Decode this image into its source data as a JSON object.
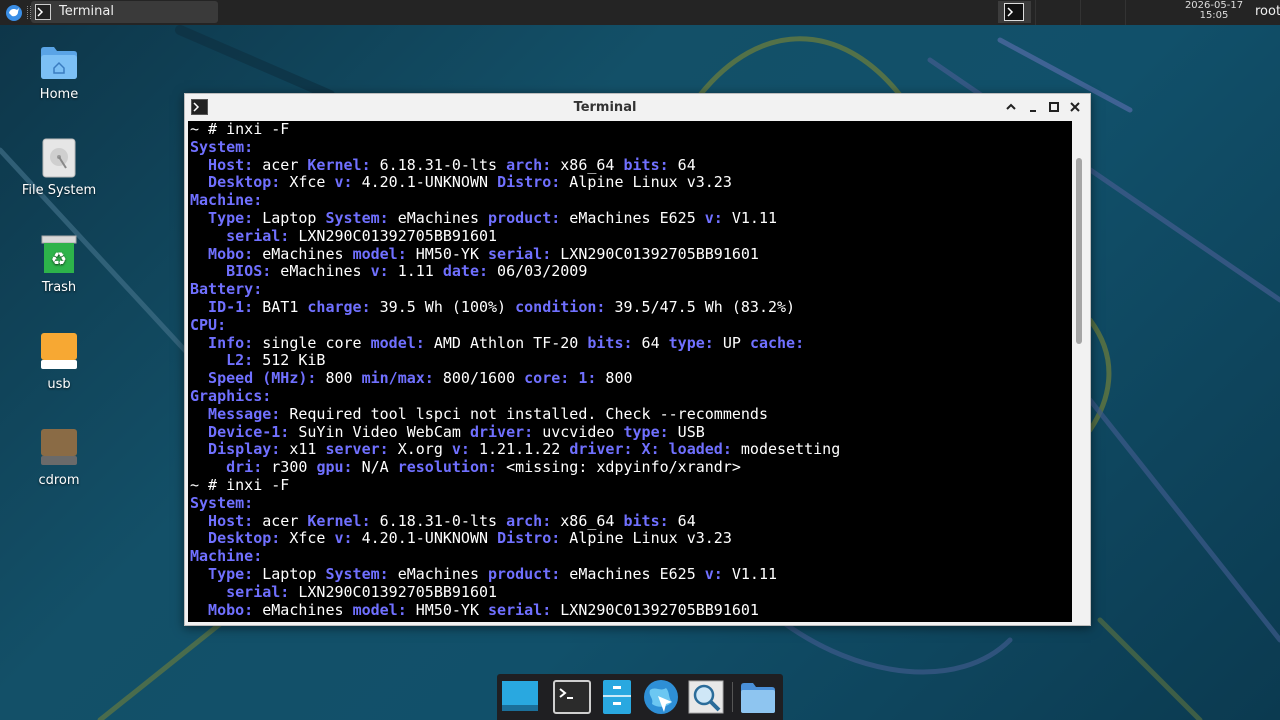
{
  "top_panel": {
    "task_title": "Terminal",
    "clock_date": "2026-05-17",
    "clock_time": "15:05",
    "user": "root"
  },
  "desktop_icons": [
    {
      "label": "Home",
      "icon": "home-folder-icon"
    },
    {
      "label": "File System",
      "icon": "drive-icon"
    },
    {
      "label": "Trash",
      "icon": "trash-icon"
    },
    {
      "label": "usb",
      "icon": "usb-drive-icon"
    },
    {
      "label": "cdrom",
      "icon": "cdrom-drive-icon"
    }
  ],
  "terminal": {
    "title": "Terminal",
    "lines": [
      [
        [
          "p",
          "~ # inxi -F"
        ]
      ],
      [
        [
          "k",
          "System:"
        ]
      ],
      [
        [
          "k",
          "  Host:"
        ],
        [
          "v",
          " acer "
        ],
        [
          "k",
          "Kernel:"
        ],
        [
          "v",
          " 6.18.31-0-lts "
        ],
        [
          "k",
          "arch:"
        ],
        [
          "v",
          " x86_64 "
        ],
        [
          "k",
          "bits:"
        ],
        [
          "v",
          " 64"
        ]
      ],
      [
        [
          "k",
          "  Desktop:"
        ],
        [
          "v",
          " Xfce "
        ],
        [
          "k",
          "v:"
        ],
        [
          "v",
          " 4.20.1-UNKNOWN "
        ],
        [
          "k",
          "Distro:"
        ],
        [
          "v",
          " Alpine Linux v3.23"
        ]
      ],
      [
        [
          "k",
          "Machine:"
        ]
      ],
      [
        [
          "k",
          "  Type:"
        ],
        [
          "v",
          " Laptop "
        ],
        [
          "k",
          "System:"
        ],
        [
          "v",
          " eMachines "
        ],
        [
          "k",
          "product:"
        ],
        [
          "v",
          " eMachines E625 "
        ],
        [
          "k",
          "v:"
        ],
        [
          "v",
          " V1.11"
        ]
      ],
      [
        [
          "k",
          "    serial:"
        ],
        [
          "v",
          " LXN290C01392705BB91601"
        ]
      ],
      [
        [
          "k",
          "  Mobo:"
        ],
        [
          "v",
          " eMachines "
        ],
        [
          "k",
          "model:"
        ],
        [
          "v",
          " HM50-YK "
        ],
        [
          "k",
          "serial:"
        ],
        [
          "v",
          " LXN290C01392705BB91601"
        ]
      ],
      [
        [
          "k",
          "    BIOS:"
        ],
        [
          "v",
          " eMachines "
        ],
        [
          "k",
          "v:"
        ],
        [
          "v",
          " 1.11 "
        ],
        [
          "k",
          "date:"
        ],
        [
          "v",
          " 06/03/2009"
        ]
      ],
      [
        [
          "k",
          "Battery:"
        ]
      ],
      [
        [
          "k",
          "  ID-1:"
        ],
        [
          "v",
          " BAT1 "
        ],
        [
          "k",
          "charge:"
        ],
        [
          "v",
          " 39.5 Wh (100%) "
        ],
        [
          "k",
          "condition:"
        ],
        [
          "v",
          " 39.5/47.5 Wh (83.2%)"
        ]
      ],
      [
        [
          "k",
          "CPU:"
        ]
      ],
      [
        [
          "k",
          "  Info:"
        ],
        [
          "v",
          " single core "
        ],
        [
          "k",
          "model:"
        ],
        [
          "v",
          " AMD Athlon TF-20 "
        ],
        [
          "k",
          "bits:"
        ],
        [
          "v",
          " 64 "
        ],
        [
          "k",
          "type:"
        ],
        [
          "v",
          " UP "
        ],
        [
          "k",
          "cache:"
        ]
      ],
      [
        [
          "k",
          "    L2:"
        ],
        [
          "v",
          " 512 KiB"
        ]
      ],
      [
        [
          "k",
          "  Speed (MHz):"
        ],
        [
          "v",
          " 800 "
        ],
        [
          "k",
          "min/max:"
        ],
        [
          "v",
          " 800/1600 "
        ],
        [
          "k",
          "core: 1:"
        ],
        [
          "v",
          " 800"
        ]
      ],
      [
        [
          "k",
          "Graphics:"
        ]
      ],
      [
        [
          "k",
          "  Message:"
        ],
        [
          "v",
          " Required tool lspci not installed. Check --recommends"
        ]
      ],
      [
        [
          "k",
          "  Device-1:"
        ],
        [
          "v",
          " SuYin Video WebCam "
        ],
        [
          "k",
          "driver:"
        ],
        [
          "v",
          " uvcvideo "
        ],
        [
          "k",
          "type:"
        ],
        [
          "v",
          " USB"
        ]
      ],
      [
        [
          "k",
          "  Display:"
        ],
        [
          "v",
          " x11 "
        ],
        [
          "k",
          "server:"
        ],
        [
          "v",
          " X.org "
        ],
        [
          "k",
          "v:"
        ],
        [
          "v",
          " 1.21.1.22 "
        ],
        [
          "k",
          "driver: X: loaded:"
        ],
        [
          "v",
          " modesetting"
        ]
      ],
      [
        [
          "k",
          "    dri:"
        ],
        [
          "v",
          " r300 "
        ],
        [
          "k",
          "gpu:"
        ],
        [
          "v",
          " N/A "
        ],
        [
          "k",
          "resolution:"
        ],
        [
          "v",
          " <missing: xdpyinfo/xrandr>"
        ]
      ],
      [
        [
          "p",
          "~ # inxi -F"
        ]
      ],
      [
        [
          "k",
          "System:"
        ]
      ],
      [
        [
          "k",
          "  Host:"
        ],
        [
          "v",
          " acer "
        ],
        [
          "k",
          "Kernel:"
        ],
        [
          "v",
          " 6.18.31-0-lts "
        ],
        [
          "k",
          "arch:"
        ],
        [
          "v",
          " x86_64 "
        ],
        [
          "k",
          "bits:"
        ],
        [
          "v",
          " 64"
        ]
      ],
      [
        [
          "k",
          "  Desktop:"
        ],
        [
          "v",
          " Xfce "
        ],
        [
          "k",
          "v:"
        ],
        [
          "v",
          " 4.20.1-UNKNOWN "
        ],
        [
          "k",
          "Distro:"
        ],
        [
          "v",
          " Alpine Linux v3.23"
        ]
      ],
      [
        [
          "k",
          "Machine:"
        ]
      ],
      [
        [
          "k",
          "  Type:"
        ],
        [
          "v",
          " Laptop "
        ],
        [
          "k",
          "System:"
        ],
        [
          "v",
          " eMachines "
        ],
        [
          "k",
          "product:"
        ],
        [
          "v",
          " eMachines E625 "
        ],
        [
          "k",
          "v:"
        ],
        [
          "v",
          " V1.11"
        ]
      ],
      [
        [
          "k",
          "    serial:"
        ],
        [
          "v",
          " LXN290C01392705BB91601"
        ]
      ],
      [
        [
          "k",
          "  Mobo:"
        ],
        [
          "v",
          " eMachines "
        ],
        [
          "k",
          "model:"
        ],
        [
          "v",
          " HM50-YK "
        ],
        [
          "k",
          "serial:"
        ],
        [
          "v",
          " LXN290C01392705BB91601"
        ]
      ]
    ],
    "colors": {
      "key": "#7070ff",
      "value": "#ffffff",
      "background": "#000000"
    }
  },
  "dock": {
    "items": [
      "desktop-icon",
      "terminal-icon",
      "file-manager-icon",
      "web-browser-icon",
      "app-finder-icon",
      "folder-icon"
    ]
  }
}
